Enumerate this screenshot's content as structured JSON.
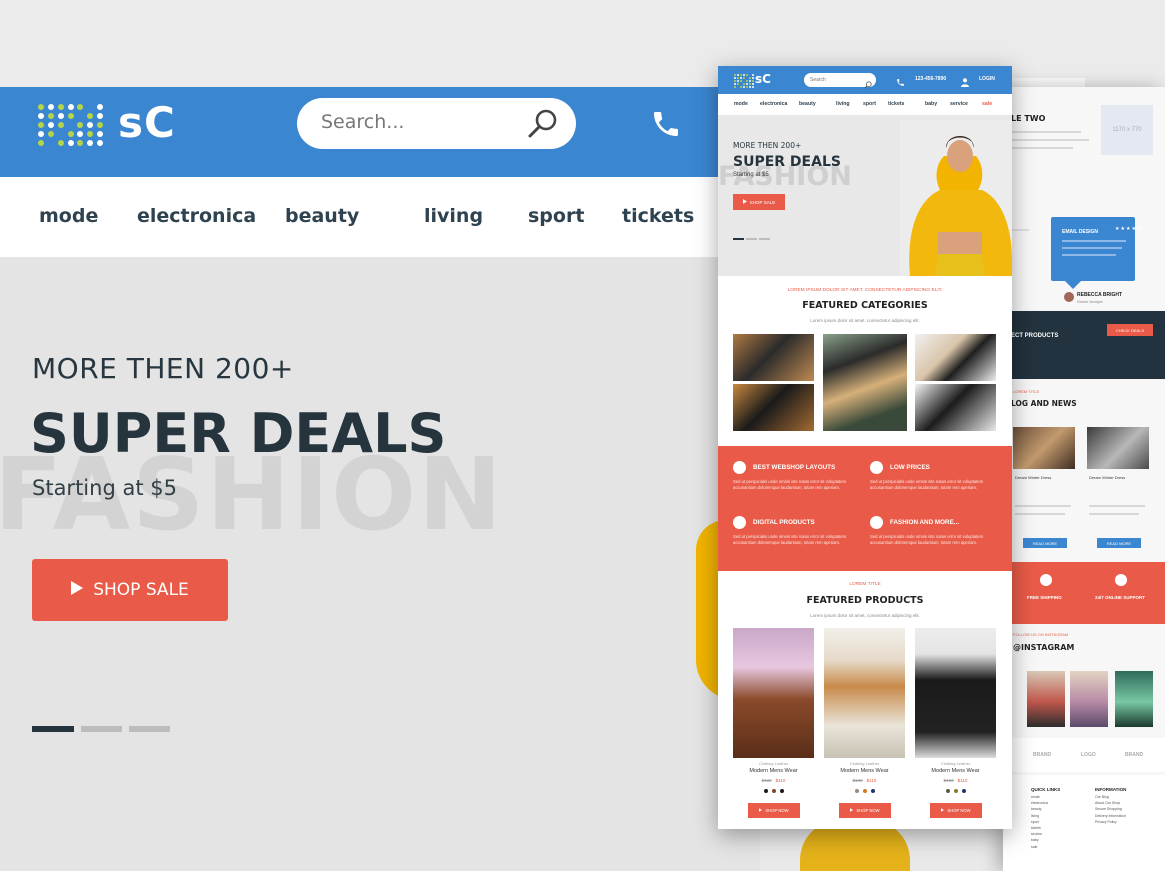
{
  "brand": {
    "logo_text": "sC",
    "colors": {
      "primary": "#3b86d1",
      "accent": "#e95b48",
      "dark": "#26343d",
      "logo_green": "#b6d44a",
      "logo_white": "#ffffff"
    }
  },
  "big": {
    "search_placeholder": "Search...",
    "nav": [
      "mode",
      "electronica",
      "beauty",
      "living",
      "sport",
      "tickets"
    ],
    "hero": {
      "more": "MORE THEN 200+",
      "headline": "SUPER DEALS",
      "bgword": "FASHION",
      "starting": "Starting at $5",
      "cta": "SHOP SALE",
      "slide_dots": 3,
      "active_slide": 1
    },
    "icons": [
      "search-icon",
      "phone-icon",
      "play-icon"
    ]
  },
  "mock": {
    "search_placeholder": "Search",
    "phone": "123-456-7890",
    "login": "LOGIN",
    "nav": [
      "mode",
      "electronica",
      "beauty",
      "living",
      "sport",
      "tickets",
      "baby",
      "service",
      "sale"
    ],
    "hero": {
      "more": "MORE THEN 200+",
      "headline": "SUPER DEALS",
      "bgword": "FASHION",
      "starting": "Starting at $5",
      "cta": "SHOP SALE"
    },
    "categories": {
      "eyebrow": "LOREM IPSUM DOLOR SIT AMET, CONSECTETUR ADIPISCING ELIT.",
      "title": "FEATURED CATEGORIES",
      "subtitle": "Lorem ipsum dolor sit amet, consectetur adipiscing elit."
    },
    "features": [
      {
        "title": "BEST WEBSHOP LAYOUTS",
        "text": "Sed ut perspiciatis unde omnis iste natus error sit voluptatem accusantium doloremque laudantium, totam rem aperiam.",
        "icon": "glasses-icon"
      },
      {
        "title": "LOW PRICES",
        "text": "Sed ut perspiciatis unde omnis iste natus error sit voluptatem accusantium doloremque laudantium, totam rem aperiam.",
        "icon": "tshirt-icon"
      },
      {
        "title": "DIGITAL PRODUCTS",
        "text": "Sed ut perspiciatis unde omnis iste natus error sit voluptatem accusantium doloremque laudantium, totam rem aperiam.",
        "icon": "cap-icon"
      },
      {
        "title": "FASHION AND MORE...",
        "text": "Sed ut perspiciatis unde omnis iste natus error sit voluptatem accusantium doloremque laudantium, totam rem aperiam.",
        "icon": "shoe-icon"
      }
    ],
    "products_section": {
      "eyebrow": "LOREM TITLE",
      "title": "FEATURED PRODUCTS",
      "subtitle": "Lorem ipsum dolor sit amet, consectetur adipiscing elit."
    },
    "products": [
      {
        "category": "Clothing Leather",
        "name": "Modern Mens Wear",
        "old_price": "$130",
        "price": "$110",
        "cta": "SHOP NOW",
        "swatches": [
          "#1c1c1c",
          "#7a4a2a",
          "#1c1c1c"
        ]
      },
      {
        "category": "Clothing Leather",
        "name": "Modern Mens Wear",
        "old_price": "$130",
        "price": "$110",
        "cta": "SHOP NOW",
        "swatches": [
          "#9a8a7a",
          "#d27a2a",
          "#22346a"
        ]
      },
      {
        "category": "Clothing Leather",
        "name": "Modern Mens Wear",
        "old_price": "$130",
        "price": "$110",
        "cta": "SHOP NOW",
        "swatches": [
          "#5a5a4a",
          "#8a7a2a",
          "#22346a"
        ]
      }
    ]
  },
  "back": {
    "table_title": "LE TWO",
    "image_placeholder": "1170 x 770",
    "review": {
      "title": "EMAIL DESIGN",
      "stars": "★★★★★",
      "name": "REBECCA BRIGHT",
      "role": "Senior Analyst"
    },
    "products_banner": {
      "title": "ECT PRODUCTS",
      "cta": "CHECK DEALS"
    },
    "blog": {
      "eyebrow": "LOREM TITLE",
      "title": "LOG AND NEWS",
      "captions": [
        "Dream Winter Dress",
        "Dream Winter Dress"
      ],
      "cta": "READ MORE"
    },
    "services": [
      "FREE SHIPPING",
      "24/7 ONLINE SUPPORT"
    ],
    "instagram": {
      "eyebrow": "FOLLOW US ON INSTAGRAM",
      "title": "@INSTAGRAM"
    },
    "brands": [
      "BRAND",
      "LOGO",
      "BRAND"
    ],
    "footer": {
      "quick_links_title": "QUICK LINKS",
      "quick_links": [
        "mode",
        "electronica",
        "beauty",
        "living",
        "sport",
        "tickets",
        "service",
        "baby",
        "sale"
      ],
      "info_title": "INFORMATION",
      "info_links": [
        "Our Blog",
        "About Our Shop",
        "Secure Shopping",
        "Delivery information",
        "Privacy Policy"
      ]
    }
  }
}
